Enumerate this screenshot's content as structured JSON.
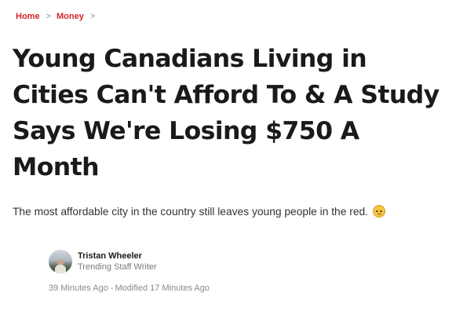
{
  "breadcrumb": {
    "home": "Home",
    "section": "Money",
    "separator": ">"
  },
  "article": {
    "headline": "Young Canadians Living in Cities Can't Afford To & A Study Says We're Losing $750 A Month",
    "subheadline": "The most affordable city in the country still leaves young people in the red.",
    "subheadline_emoji": "disappointed-face-icon"
  },
  "author": {
    "name": "Tristan Wheeler",
    "role": "Trending Staff Writer"
  },
  "meta": {
    "published": "39 Minutes Ago",
    "separator": "-",
    "modified": "Modified 17 Minutes Ago"
  },
  "colors": {
    "link": "#d0262e",
    "text": "#1a1a1a",
    "muted": "#8a8a8a"
  }
}
